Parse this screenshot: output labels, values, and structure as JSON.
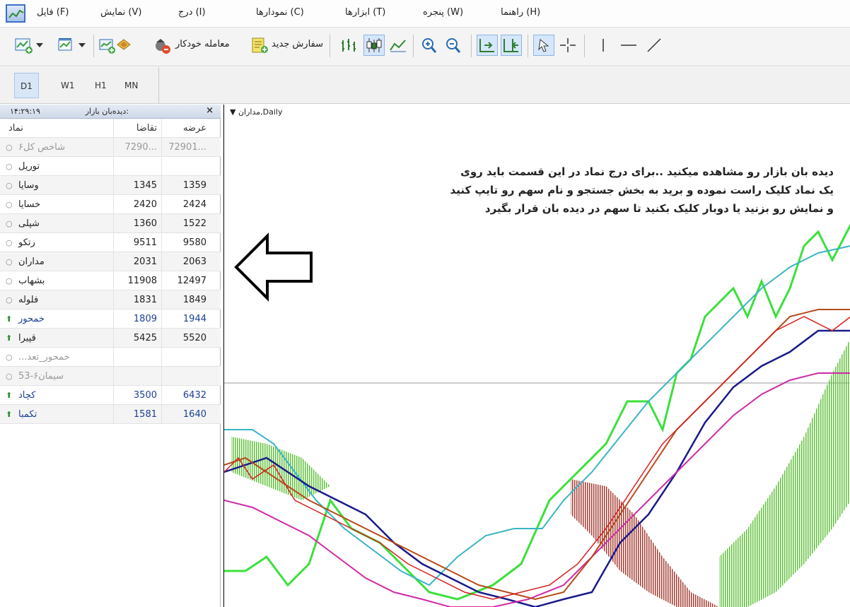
{
  "menu": {
    "help": "راهنما (H)",
    "window": "پنجره (W)",
    "tools": "ابزارها (T)",
    "charts": "نمودارها (C)",
    "insert": "درج (I)",
    "view": "نمایش (V)",
    "file": "فایل (F)"
  },
  "toolbar": {
    "auto_trading": "معامله خودکار",
    "new_order": "سفارش جدید"
  },
  "timeframes": [
    "D1",
    "W1",
    "H1",
    "MN"
  ],
  "market_watch": {
    "title": "دیده‌بان بازار:",
    "clock": "۱۴:۲۹:۱۹",
    "close": "×",
    "headers": {
      "symbol": "نماد",
      "bid": "تقاضا",
      "ask": "عرضه"
    },
    "rows": [
      {
        "symbol": "شاخص کل۶",
        "bid": "7290...",
        "ask": "72901...",
        "style": "gray",
        "mark": "dot"
      },
      {
        "symbol": "توریل",
        "bid": "",
        "ask": "",
        "style": "normal",
        "mark": "dot"
      },
      {
        "symbol": "وسایا",
        "bid": "1345",
        "ask": "1359",
        "style": "normal",
        "mark": "dot"
      },
      {
        "symbol": "خسایا",
        "bid": "2420",
        "ask": "2424",
        "style": "normal",
        "mark": "dot"
      },
      {
        "symbol": "شپلی",
        "bid": "1360",
        "ask": "1522",
        "style": "normal",
        "mark": "dot"
      },
      {
        "symbol": "رتکو",
        "bid": "9511",
        "ask": "9580",
        "style": "normal",
        "mark": "dot"
      },
      {
        "symbol": "مداران",
        "bid": "2031",
        "ask": "2063",
        "style": "normal",
        "mark": "dot"
      },
      {
        "symbol": "بشهاب",
        "bid": "11908",
        "ask": "12497",
        "style": "normal",
        "mark": "dot"
      },
      {
        "symbol": "فلوله",
        "bid": "1831",
        "ask": "1849",
        "style": "normal",
        "mark": "dot"
      },
      {
        "symbol": "خمحور",
        "bid": "1809",
        "ask": "1944",
        "style": "blue",
        "mark": "up"
      },
      {
        "symbol": "قپیرا",
        "bid": "5425",
        "ask": "5520",
        "style": "normal",
        "mark": "up"
      },
      {
        "symbol": "...خمحور_تعد",
        "bid": "",
        "ask": "",
        "style": "gray",
        "mark": "dot"
      },
      {
        "symbol": "سیمان۶-53",
        "bid": "",
        "ask": "",
        "style": "gray",
        "mark": "dot"
      },
      {
        "symbol": "کچاد",
        "bid": "3500",
        "ask": "6432",
        "style": "blue",
        "mark": "up"
      },
      {
        "symbol": "تکمبا",
        "bid": "1581",
        "ask": "1640",
        "style": "blue",
        "mark": "up"
      }
    ]
  },
  "chart": {
    "title": "مداران,Daily",
    "note_lines": [
      "دیده بان بازار رو مشاهده میکنید ..برای درج نماد در این قسمت باید روی",
      "یک نماد کلیک راست نموده و برید به بخش جستجو و نام سهم رو تایپ کنید",
      "و نمایش رو بزنید یا دوبار کلیک بکنید تا سهم در دیده بان قرار بگیرد"
    ]
  },
  "colors": {
    "accent": "#3b6fc4",
    "up_arrow": "#2e8b2e",
    "blue_text": "#1c3f95"
  }
}
